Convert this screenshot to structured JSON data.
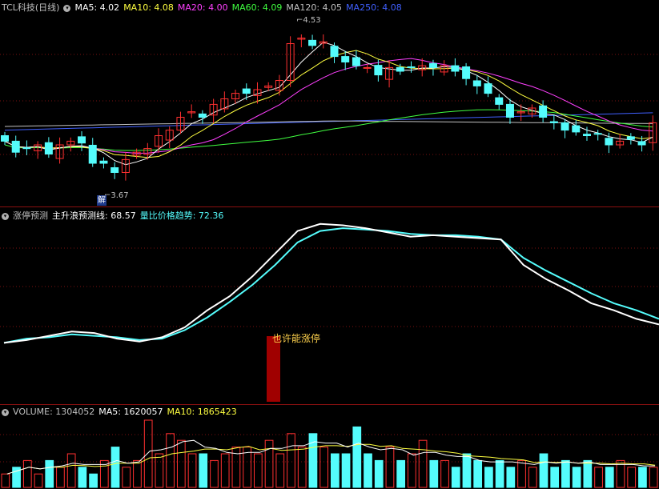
{
  "price": {
    "title": "TCL科技(日线)",
    "ma": [
      {
        "label": "MA5: 4.02",
        "color": "#ffffff"
      },
      {
        "label": "MA10: 4.08",
        "color": "#ffff40"
      },
      {
        "label": "MA20: 4.00",
        "color": "#ff40ff"
      },
      {
        "label": "MA60: 4.09",
        "color": "#40ff40"
      },
      {
        "label": "MA120: 4.05",
        "color": "#c0c0c0"
      },
      {
        "label": "MA250: 4.08",
        "color": "#4060ff"
      }
    ],
    "high_label": "4.53",
    "low_label": "3.67",
    "badge": "解"
  },
  "indicator": {
    "name": "涨停预测",
    "line1": "主升浪预测线: 68.57",
    "line2": "量比价格趋势: 72.36",
    "signal": "也许能涨停"
  },
  "volume": {
    "label": "VOLUME: 1304052",
    "ma5": "MA5: 1620057",
    "ma10": "MA10: 1865423"
  },
  "colors": {
    "up": "#ff3030",
    "down": "#54fcfc",
    "signal_bar": "#a00000"
  },
  "chart_data": {
    "type": "candlestick",
    "ohlc_close_series_approx": [
      3.92,
      3.86,
      3.88,
      3.9,
      3.85,
      3.9,
      3.92,
      3.91,
      3.8,
      3.8,
      3.75,
      3.82,
      3.86,
      3.88,
      3.95,
      3.98,
      4.05,
      4.08,
      4.05,
      4.12,
      4.15,
      4.18,
      4.18,
      4.2,
      4.22,
      4.25,
      4.45,
      4.48,
      4.44,
      4.46,
      4.38,
      4.35,
      4.33,
      4.32,
      4.28,
      4.32,
      4.3,
      4.32,
      4.33,
      4.32,
      4.33,
      4.3,
      4.26,
      4.22,
      4.18,
      4.12,
      4.05,
      4.08,
      4.1,
      4.05,
      4.02,
      3.98,
      3.97,
      3.95,
      3.96,
      3.9,
      3.92,
      3.93,
      3.9,
      4.02
    ],
    "indicator_series": {
      "主升浪预测线": [
        15,
        17,
        20,
        23,
        22,
        18,
        16,
        19,
        26,
        38,
        48,
        62,
        78,
        94,
        99,
        98,
        96,
        93,
        90,
        91,
        90,
        89,
        88,
        70,
        60,
        52,
        43,
        38,
        32,
        28
      ],
      "量比价格趋势": [
        15,
        18,
        19,
        21,
        20,
        19,
        17,
        18,
        24,
        33,
        44,
        56,
        70,
        86,
        94,
        96,
        95,
        94,
        92,
        91,
        91,
        90,
        88,
        75,
        66,
        58,
        50,
        43,
        38,
        32
      ]
    },
    "volume_series": [
      0.2,
      0.3,
      0.4,
      0.2,
      0.4,
      0.3,
      0.5,
      0.3,
      0.2,
      0.4,
      0.6,
      0.3,
      0.4,
      1.0,
      0.5,
      0.8,
      0.7,
      0.5,
      0.5,
      0.4,
      0.5,
      0.6,
      0.6,
      0.5,
      0.7,
      0.5,
      0.8,
      0.6,
      0.8,
      0.6,
      0.5,
      0.5,
      0.9,
      0.5,
      0.4,
      0.6,
      0.4,
      0.5,
      0.7,
      0.4,
      0.4,
      0.3,
      0.5,
      0.4,
      0.3,
      0.4,
      0.3,
      0.4,
      0.3,
      0.5,
      0.3,
      0.4,
      0.3,
      0.4,
      0.3,
      0.3,
      0.4,
      0.3,
      0.3,
      0.3
    ]
  }
}
